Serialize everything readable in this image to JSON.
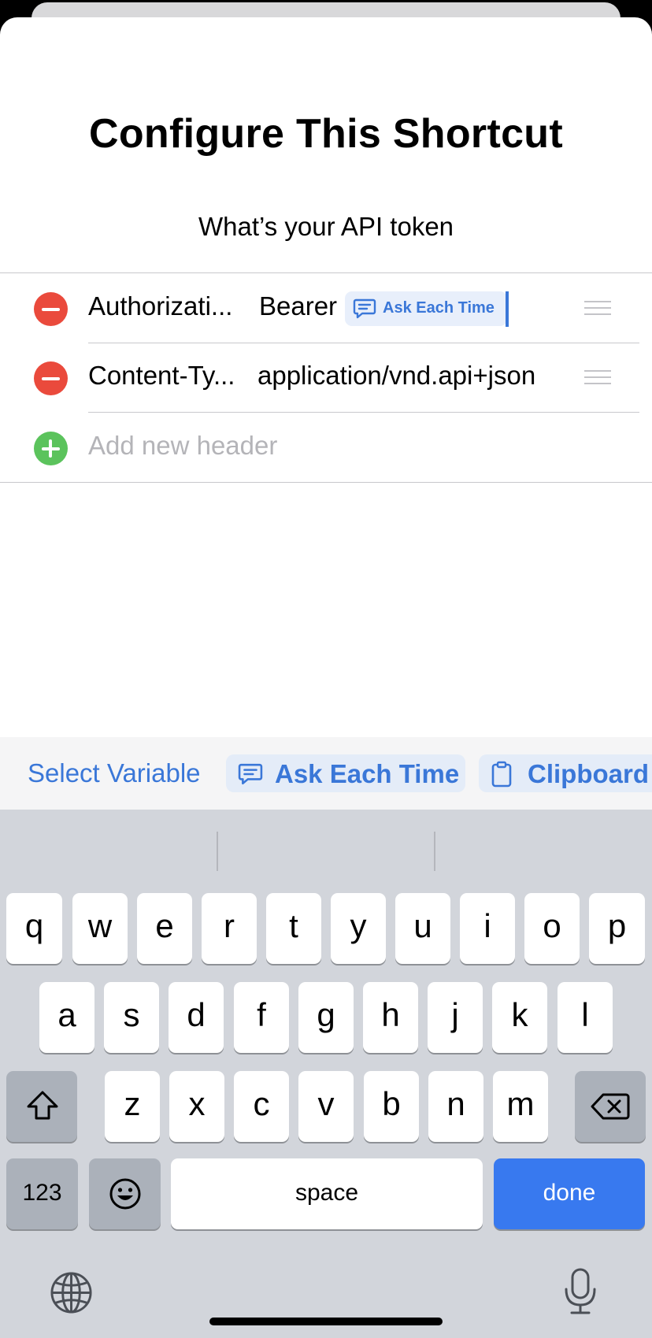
{
  "sheet": {
    "title": "Configure This Shortcut",
    "prompt": "What’s your API token"
  },
  "headers": [
    {
      "key": "Authorizati...",
      "value_prefix": "Bearer",
      "variable": "Ask Each Time"
    },
    {
      "key": "Content-Ty...",
      "value": "application/vnd.api+json"
    }
  ],
  "add_header_placeholder": "Add new header",
  "variable_bar": {
    "select_label": "Select Variable",
    "ask_label": "Ask Each Time",
    "clipboard_label": "Clipboard"
  },
  "keyboard": {
    "row1": [
      "q",
      "w",
      "e",
      "r",
      "t",
      "y",
      "u",
      "i",
      "o",
      "p"
    ],
    "row2": [
      "a",
      "s",
      "d",
      "f",
      "g",
      "h",
      "j",
      "k",
      "l"
    ],
    "row3": [
      "z",
      "x",
      "c",
      "v",
      "b",
      "n",
      "m"
    ],
    "numbers_label": "123",
    "space_label": "space",
    "done_label": "done"
  },
  "colors": {
    "accent": "#3a77d8",
    "delete": "#ea4a3c",
    "add": "#5bc35c",
    "done_key": "#3879ef"
  }
}
